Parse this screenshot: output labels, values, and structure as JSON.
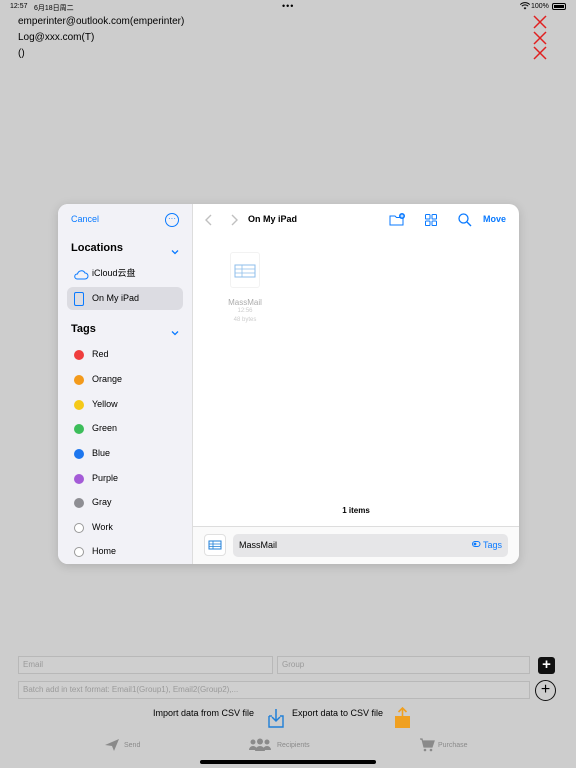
{
  "status": {
    "time": "12:57",
    "date": "6月18日周二",
    "battery": "100%"
  },
  "recipients": [
    "emperinter@outlook.com(emperinter)",
    "Log@xxx.com(T)",
    "()"
  ],
  "picker": {
    "cancel": "Cancel",
    "locations_header": "Locations",
    "locations": [
      {
        "label": "iCloud云盘",
        "icon": "cloud-icon"
      },
      {
        "label": "On My iPad",
        "icon": "ipad-icon",
        "selected": true
      }
    ],
    "tags_header": "Tags",
    "tags": [
      {
        "label": "Red",
        "color": "#ef3d3d"
      },
      {
        "label": "Orange",
        "color": "#f39a1b"
      },
      {
        "label": "Yellow",
        "color": "#f5c918"
      },
      {
        "label": "Green",
        "color": "#3cbd5a"
      },
      {
        "label": "Blue",
        "color": "#1d76ee"
      },
      {
        "label": "Purple",
        "color": "#a45bd7"
      },
      {
        "label": "Gray",
        "color": "#8e8e93"
      },
      {
        "label": "Work",
        "color": ""
      },
      {
        "label": "Home",
        "color": ""
      }
    ],
    "title": "On My iPad",
    "move": "Move",
    "file": {
      "name": "MassMail",
      "time": "12:56",
      "size": "48 bytes"
    },
    "item_count": "1 items",
    "filename_value": "MassMail",
    "tags_link": "Tags"
  },
  "form": {
    "email_placeholder": "Email",
    "group_placeholder": "Group",
    "batch_placeholder": "Batch add in text format: Email1(Group1), Email2(Group2),..."
  },
  "csv": {
    "import_label": "Import data from CSV file",
    "export_label": "Export data to CSV file"
  },
  "tabs": [
    {
      "label": "Send",
      "icon": "send-icon"
    },
    {
      "label": "Recipients",
      "icon": "people-icon"
    },
    {
      "label": "Purchase",
      "icon": "cart-icon"
    }
  ],
  "colors": {
    "accent": "#0a7aff",
    "delete_red": "#e02020",
    "export_orange": "#f0a020",
    "import_blue": "#1f7fd8"
  }
}
